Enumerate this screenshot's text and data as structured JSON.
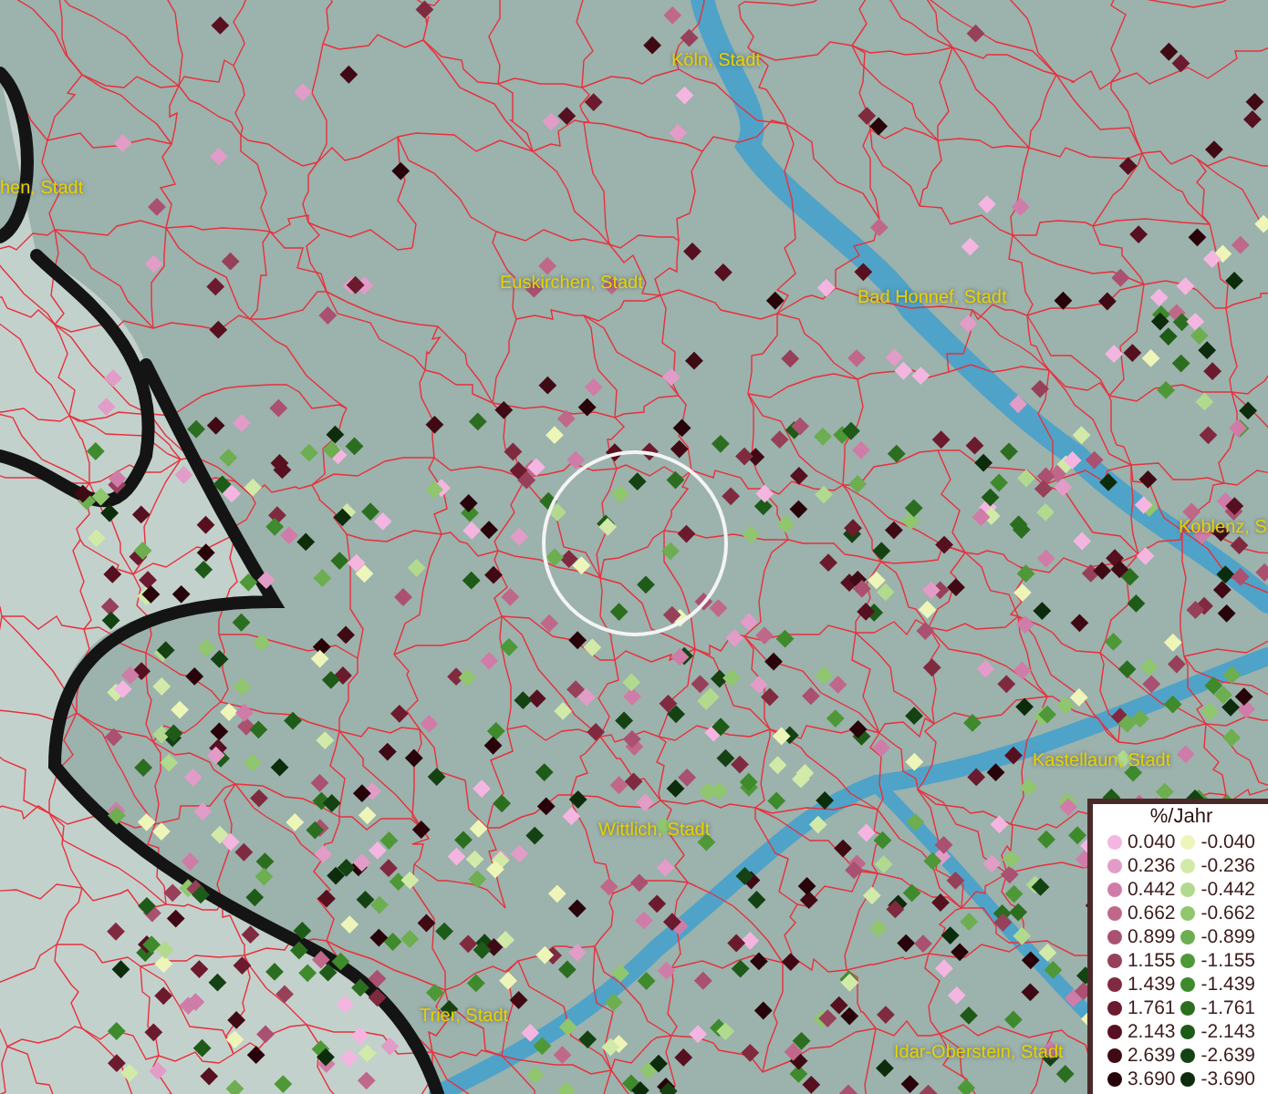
{
  "map": {
    "place_labels": [
      {
        "text": "Köln, Stadt"
      },
      {
        "text": "hen, Stadt"
      },
      {
        "text": "Euskirchen, Stadt"
      },
      {
        "text": "Bad Honnef, Stadt"
      },
      {
        "text": "Koblenz, S"
      },
      {
        "text": "Kastellaun, Stadt"
      },
      {
        "text": "Wittlich, Stadt"
      },
      {
        "text": "Trier, Stadt"
      },
      {
        "text": "Idar-Oberstein, Stadt"
      }
    ]
  },
  "legend": {
    "title": "%/Jahr",
    "positive": [
      {
        "value": "0.040",
        "color": "#f4b6e0"
      },
      {
        "value": "0.236",
        "color": "#e29cc8"
      },
      {
        "value": "0.442",
        "color": "#d07ca8"
      },
      {
        "value": "0.662",
        "color": "#c0688a"
      },
      {
        "value": "0.899",
        "color": "#aa5070"
      },
      {
        "value": "1.155",
        "color": "#96405a"
      },
      {
        "value": "1.439",
        "color": "#802a40"
      },
      {
        "value": "1.761",
        "color": "#6c1a2e"
      },
      {
        "value": "2.143",
        "color": "#561020"
      },
      {
        "value": "2.639",
        "color": "#400a14"
      },
      {
        "value": "3.690",
        "color": "#28040a"
      }
    ],
    "negative": [
      {
        "value": "-0.040",
        "color": "#eef5b8"
      },
      {
        "value": "-0.236",
        "color": "#d2eaa8"
      },
      {
        "value": "-0.442",
        "color": "#b2da8e"
      },
      {
        "value": "-0.662",
        "color": "#90c66e"
      },
      {
        "value": "-0.899",
        "color": "#6cae50"
      },
      {
        "value": "-1.155",
        "color": "#4f9838"
      },
      {
        "value": "-1.439",
        "color": "#3e8a2c"
      },
      {
        "value": "-1.761",
        "color": "#2c6e20"
      },
      {
        "value": "-2.143",
        "color": "#1e5a18"
      },
      {
        "value": "-2.639",
        "color": "#144212"
      },
      {
        "value": "-3.690",
        "color": "#0c2c0c"
      }
    ]
  }
}
